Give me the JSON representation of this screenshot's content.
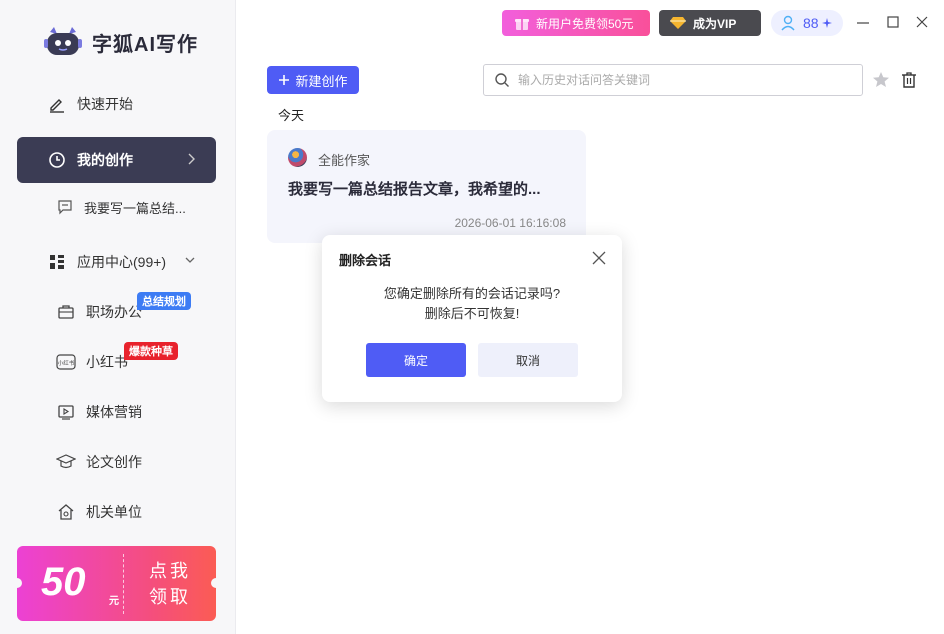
{
  "app": {
    "name": "字狐AI写作"
  },
  "sidebar": {
    "quick_start": "快速开始",
    "my_creations": "我的创作",
    "recent_item": "我要写一篇总结...",
    "app_center": "应用中心(99+)",
    "apps": [
      {
        "label": "职场办公",
        "tag": "总结规划",
        "tag_color": "#3d7cf4",
        "icon": "briefcase-icon"
      },
      {
        "label": "小红书",
        "tag": "爆款种草",
        "tag_color": "#e8222c",
        "icon": "xiaohongshu-icon"
      },
      {
        "label": "媒体营销",
        "tag": "",
        "icon": "video-icon"
      },
      {
        "label": "论文创作",
        "tag": "",
        "icon": "graduation-cap-icon"
      },
      {
        "label": "机关单位",
        "tag": "",
        "icon": "government-building-icon"
      }
    ],
    "promo": {
      "amount": "50",
      "unit": "元",
      "cta": "点我领取"
    }
  },
  "topbar": {
    "new_user": "新用户免费领50元",
    "vip": "成为VIP",
    "points": "88"
  },
  "main": {
    "new_button": "新建创作",
    "search_placeholder": "输入历史对话问答关键词",
    "date_group": "今天",
    "card": {
      "author": "全能作家",
      "title": "我要写一篇总结报告文章，我希望的...",
      "time": "2026-06-01 16:16:08"
    }
  },
  "modal": {
    "title": "删除会话",
    "line1": "您确定删除所有的会话记录吗?",
    "line2": "删除后不可恢复!",
    "ok": "确定",
    "cancel": "取消"
  },
  "colors": {
    "accent": "#4f5cf5",
    "sidebar_active": "#3b3c54"
  }
}
